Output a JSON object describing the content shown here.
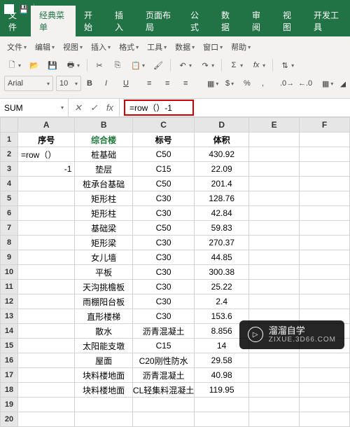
{
  "qat": {
    "save": "💾",
    "undo": "↶",
    "redo": "↷"
  },
  "tabs": [
    "文件",
    "经典菜单",
    "开始",
    "插入",
    "页面布局",
    "公式",
    "数据",
    "审阅",
    "视图",
    "开发工具"
  ],
  "active_tab_index": 1,
  "ribbon_row1": [
    "文件",
    "编辑",
    "视图",
    "插入",
    "格式",
    "工具",
    "数据",
    "窗口",
    "帮助"
  ],
  "ribbon_row3": {
    "font": "Arial",
    "size": "10"
  },
  "namebox": "SUM",
  "formula": "=row（）-1",
  "columns": [
    "A",
    "B",
    "C",
    "D",
    "E",
    "F"
  ],
  "row_count": 20,
  "header_row": [
    "序号",
    "综合楼",
    "标号",
    "体积"
  ],
  "editing_cell": {
    "r": 2,
    "c": 0,
    "text": "=row（）"
  },
  "continuation_cell": {
    "r": 3,
    "c": 0,
    "text": "-1"
  },
  "data_rows": [
    [
      "",
      "桩基础",
      "C50",
      "430.92"
    ],
    [
      "",
      "垫层",
      "C15",
      "22.09"
    ],
    [
      "",
      "桩承台基础",
      "C50",
      "201.4"
    ],
    [
      "",
      "矩形柱",
      "C30",
      "128.76"
    ],
    [
      "",
      "矩形柱",
      "C30",
      "42.84"
    ],
    [
      "",
      "基础梁",
      "C50",
      "59.83"
    ],
    [
      "",
      "矩形梁",
      "C30",
      "270.37"
    ],
    [
      "",
      "女儿墙",
      "C30",
      "44.85"
    ],
    [
      "",
      "平板",
      "C30",
      "300.38"
    ],
    [
      "",
      "天沟挑檐板",
      "C30",
      "25.22"
    ],
    [
      "",
      "雨棚阳台板",
      "C30",
      "2.4"
    ],
    [
      "",
      "直形楼梯",
      "C30",
      "153.6"
    ],
    [
      "",
      "散水",
      "沥青混凝土",
      "8.856"
    ],
    [
      "",
      "太阳能支墩",
      "C15",
      "14"
    ],
    [
      "",
      "屋面",
      "C20刚性防水",
      "29.58"
    ],
    [
      "",
      "块料楼地面",
      "沥青混凝土",
      "40.98"
    ],
    [
      "",
      "块料楼地面",
      "CL轻集料混凝土",
      "119.95"
    ],
    [
      "",
      "",
      "",
      ""
    ],
    [
      "",
      "",
      "",
      ""
    ]
  ],
  "watermark": {
    "brand": "溜溜自学",
    "sub": "ZIXUE.3D66.COM",
    "play": "▷"
  },
  "chart_data": {
    "type": "table",
    "title": "综合楼",
    "columns": [
      "序号",
      "综合楼",
      "标号",
      "体积"
    ],
    "rows": [
      [
        "",
        "桩基础",
        "C50",
        430.92
      ],
      [
        "",
        "垫层",
        "C15",
        22.09
      ],
      [
        "",
        "桩承台基础",
        "C50",
        201.4
      ],
      [
        "",
        "矩形柱",
        "C30",
        128.76
      ],
      [
        "",
        "矩形柱",
        "C30",
        42.84
      ],
      [
        "",
        "基础梁",
        "C50",
        59.83
      ],
      [
        "",
        "矩形梁",
        "C30",
        270.37
      ],
      [
        "",
        "女儿墙",
        "C30",
        44.85
      ],
      [
        "",
        "平板",
        "C30",
        300.38
      ],
      [
        "",
        "天沟挑檐板",
        "C30",
        25.22
      ],
      [
        "",
        "雨棚阳台板",
        "C30",
        2.4
      ],
      [
        "",
        "直形楼梯",
        "C30",
        153.6
      ],
      [
        "",
        "散水",
        "沥青混凝土",
        8.856
      ],
      [
        "",
        "太阳能支墩",
        "C15",
        14
      ],
      [
        "",
        "屋面",
        "C20刚性防水",
        29.58
      ],
      [
        "",
        "块料楼地面",
        "沥青混凝土",
        40.98
      ],
      [
        "",
        "块料楼地面",
        "CL轻集料混凝土",
        119.95
      ]
    ]
  }
}
